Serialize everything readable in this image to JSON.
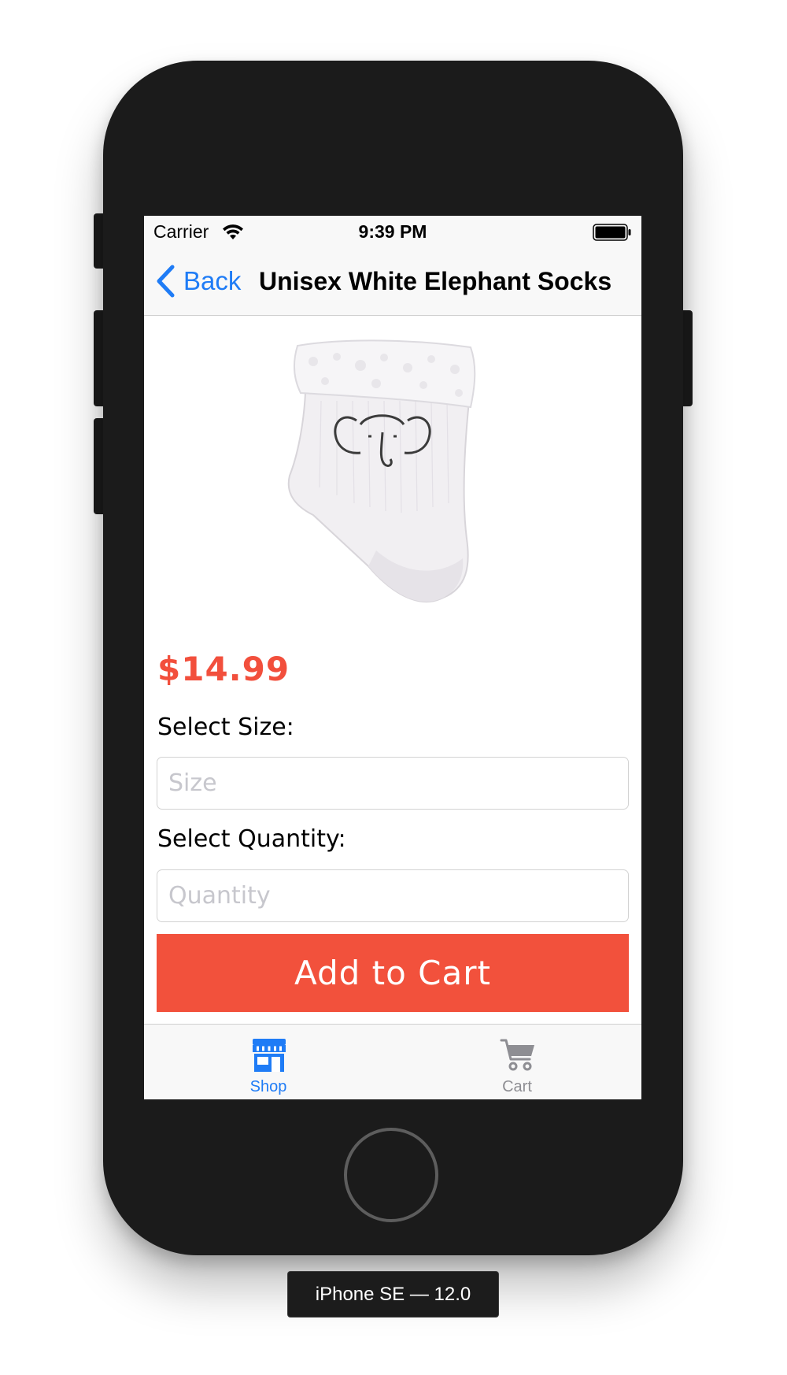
{
  "device": {
    "label": "iPhone SE — 12.0"
  },
  "status_bar": {
    "carrier": "Carrier",
    "time": "9:39 PM"
  },
  "nav": {
    "back_label": "Back",
    "title": "Unisex White Elephant Socks"
  },
  "product": {
    "image_icon": "sock-elephant-photo",
    "price": "$14.99",
    "size_label": "Select Size:",
    "size_placeholder": "Size",
    "quantity_label": "Select Quantity:",
    "quantity_placeholder": "Quantity",
    "add_to_cart_label": "Add to Cart"
  },
  "tabs": [
    {
      "label": "Shop",
      "icon": "storefront-icon",
      "selected": true
    },
    {
      "label": "Cart",
      "icon": "cart-icon",
      "selected": false
    }
  ],
  "colors": {
    "accent": "#1f7cf6",
    "price": "#f24f3c",
    "button": "#f2513c",
    "device": "#1b1b1b"
  }
}
